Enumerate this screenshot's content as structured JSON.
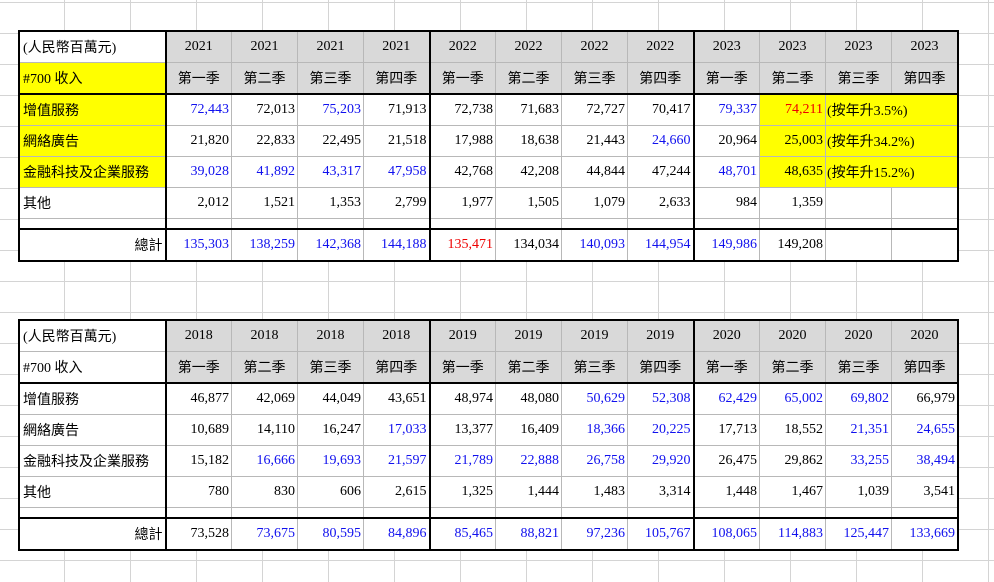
{
  "table_2021_2023": {
    "unit_label": "(人民幣百萬元)",
    "code_label": "#700 收入",
    "years": [
      "2021",
      "2021",
      "2021",
      "2021",
      "2022",
      "2022",
      "2022",
      "2022",
      "2023",
      "2023",
      "2023",
      "2023"
    ],
    "quarters": [
      "第一季",
      "第二季",
      "第三季",
      "第四季",
      "第一季",
      "第二季",
      "第三季",
      "第四季",
      "第一季",
      "第二季",
      "第三季",
      "第四季"
    ],
    "rows": [
      {
        "label": "增值服務",
        "values": [
          "72,443",
          "72,013",
          "75,203",
          "71,913",
          "72,738",
          "71,683",
          "72,727",
          "70,417",
          "79,337",
          "74,211"
        ],
        "note": "(按年升3.5%)"
      },
      {
        "label": "網絡廣告",
        "values": [
          "21,820",
          "22,833",
          "22,495",
          "21,518",
          "17,988",
          "18,638",
          "21,443",
          "24,660",
          "20,964",
          "25,003"
        ],
        "note": "(按年升34.2%)"
      },
      {
        "label": "金融科技及企業服務",
        "values": [
          "39,028",
          "41,892",
          "43,317",
          "47,958",
          "42,768",
          "42,208",
          "44,844",
          "47,244",
          "48,701",
          "48,635"
        ],
        "note": "(按年升15.2%)"
      },
      {
        "label": "其他",
        "values": [
          "2,012",
          "1,521",
          "1,353",
          "2,799",
          "1,977",
          "1,505",
          "1,079",
          "2,633",
          "984",
          "1,359"
        ],
        "note": ""
      }
    ],
    "total_label": "總計",
    "totals": [
      "135,303",
      "138,259",
      "142,368",
      "144,188",
      "135,471",
      "134,034",
      "140,093",
      "144,954",
      "149,986",
      "149,208"
    ]
  },
  "table_2018_2020": {
    "unit_label": "(人民幣百萬元)",
    "code_label": "#700 收入",
    "years": [
      "2018",
      "2018",
      "2018",
      "2018",
      "2019",
      "2019",
      "2019",
      "2019",
      "2020",
      "2020",
      "2020",
      "2020"
    ],
    "quarters": [
      "第一季",
      "第二季",
      "第三季",
      "第四季",
      "第一季",
      "第二季",
      "第三季",
      "第四季",
      "第一季",
      "第二季",
      "第三季",
      "第四季"
    ],
    "rows": [
      {
        "label": "增值服務",
        "values": [
          "46,877",
          "42,069",
          "44,049",
          "43,651",
          "48,974",
          "48,080",
          "50,629",
          "52,308",
          "62,429",
          "65,002",
          "69,802",
          "66,979"
        ]
      },
      {
        "label": "網絡廣告",
        "values": [
          "10,689",
          "14,110",
          "16,247",
          "17,033",
          "13,377",
          "16,409",
          "18,366",
          "20,225",
          "17,713",
          "18,552",
          "21,351",
          "24,655"
        ]
      },
      {
        "label": "金融科技及企業服務",
        "values": [
          "15,182",
          "16,666",
          "19,693",
          "21,597",
          "21,789",
          "22,888",
          "26,758",
          "29,920",
          "26,475",
          "29,862",
          "33,255",
          "38,494"
        ]
      },
      {
        "label": "其他",
        "values": [
          "780",
          "830",
          "606",
          "2,615",
          "1,325",
          "1,444",
          "1,483",
          "3,314",
          "1,448",
          "1,467",
          "1,039",
          "3,541"
        ]
      }
    ],
    "total_label": "總計",
    "totals": [
      "73,528",
      "73,675",
      "80,595",
      "84,896",
      "85,465",
      "88,821",
      "97,236",
      "105,767",
      "108,065",
      "114,883",
      "125,447",
      "133,669"
    ]
  },
  "colors": {
    "header_gray": "#d9d9d9",
    "highlight_yellow": "#ffff00",
    "blue_text": "#1010ee",
    "red_text": "#ee0000"
  }
}
